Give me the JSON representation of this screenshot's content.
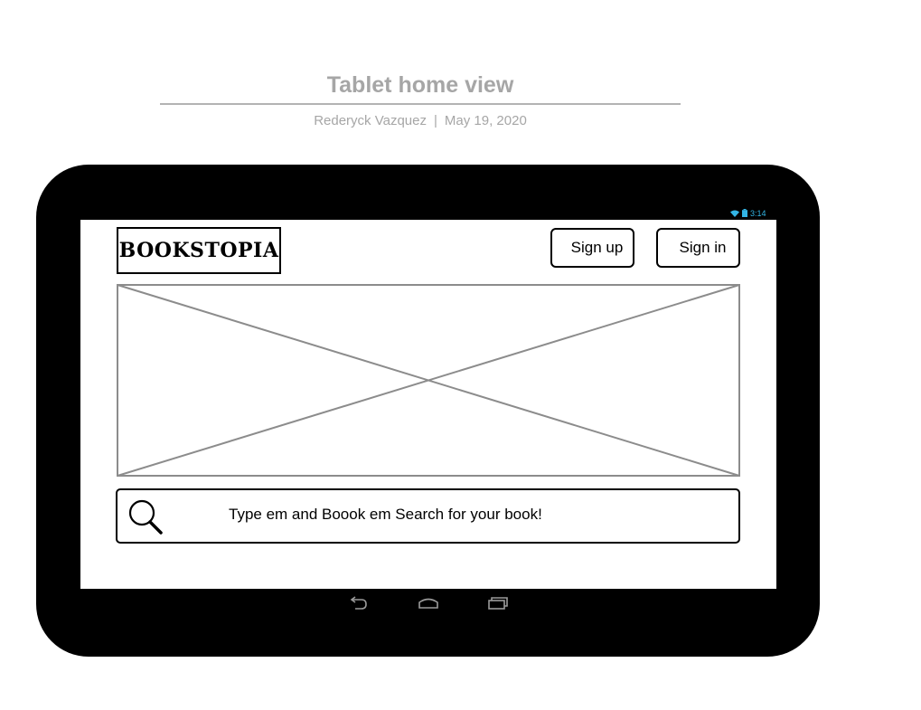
{
  "document": {
    "title": "Tablet home view",
    "author": "Rederyck Vazquez",
    "separator": "|",
    "date": "May 19, 2020"
  },
  "status_bar": {
    "time": "3:14",
    "icons": [
      "wifi-icon",
      "battery-icon"
    ],
    "color": "#33b5e5"
  },
  "header": {
    "logo_text": "BOOKSTOPIA",
    "signup_label": "Sign up",
    "signin_label": "Sign in"
  },
  "hero": {
    "type": "image-placeholder"
  },
  "search": {
    "icon": "search-icon",
    "text": "Type em and Boook em Search for your book!"
  },
  "nav_bar": {
    "buttons": [
      "back-icon",
      "home-icon",
      "recents-icon"
    ]
  },
  "colors": {
    "device_frame": "#000000",
    "screen": "#ffffff",
    "placeholder_stroke": "#8c8c8c",
    "doc_text": "#a6a6a6"
  }
}
